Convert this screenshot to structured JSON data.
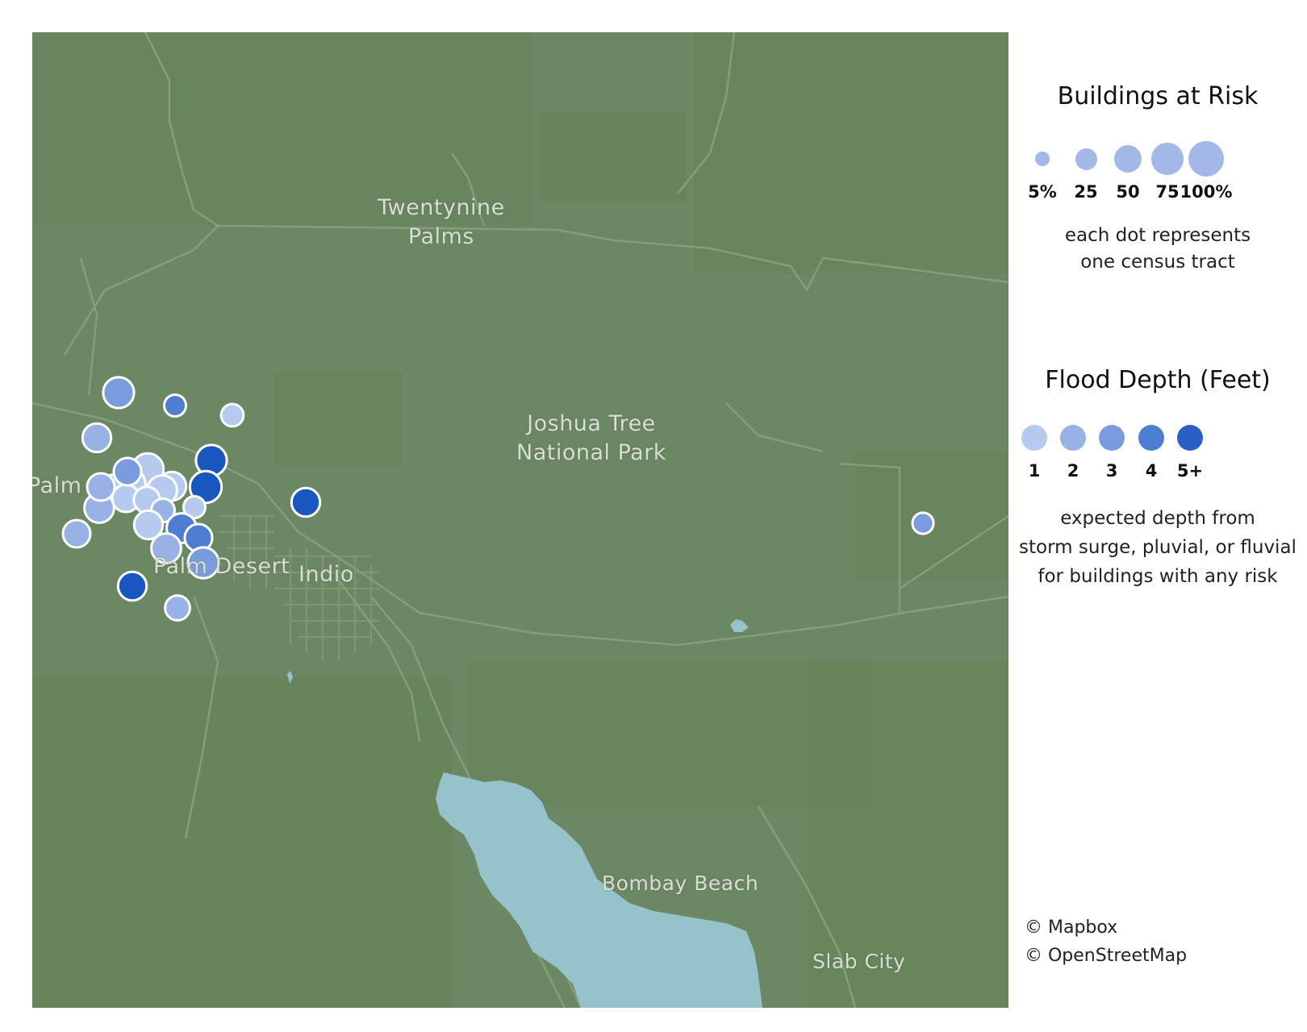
{
  "map": {
    "places": [
      {
        "name": "Twentynine Palms",
        "line1": "Twentynine",
        "line2": "Palms"
      },
      {
        "name": "Joshua Tree National Park",
        "line1": "Joshua Tree",
        "line2": "National Park"
      },
      {
        "name": "Palm",
        "line1": "Palm",
        "line2": ""
      },
      {
        "name": "Palm Desert",
        "line1": "Palm Desert",
        "line2": ""
      },
      {
        "name": "Indio",
        "line1": "Indio",
        "line2": ""
      },
      {
        "name": "Bombay Beach",
        "line1": "Bombay Beach",
        "line2": ""
      },
      {
        "name": "Slab City",
        "line1": "Slab City",
        "line2": ""
      }
    ],
    "colors": {
      "land": "#6b8763",
      "land_dark": "#63814f",
      "water": "#96c3cb",
      "road": "#8aa07f",
      "marker_stroke": "#ffffff",
      "depth_1": "#b6c9ee",
      "depth_2": "#98b2e6",
      "depth_3": "#7a9cdf",
      "depth_4": "#4f7dd2",
      "depth_5plus": "#1a56bf"
    },
    "tracts": [
      {
        "buildings_at_risk_pct": 55,
        "flood_depth_ft": 3
      },
      {
        "buildings_at_risk_pct": 20,
        "flood_depth_ft": 4
      },
      {
        "buildings_at_risk_pct": 22,
        "flood_depth_ft": 1
      },
      {
        "buildings_at_risk_pct": 45,
        "flood_depth_ft": 2
      },
      {
        "buildings_at_risk_pct": 40,
        "flood_depth_ft": 2
      },
      {
        "buildings_at_risk_pct": 50,
        "flood_depth_ft": 2
      },
      {
        "buildings_at_risk_pct": 60,
        "flood_depth_ft": 1
      },
      {
        "buildings_at_risk_pct": 55,
        "flood_depth_ft": 1
      },
      {
        "buildings_at_risk_pct": 45,
        "flood_depth_ft": 1
      },
      {
        "buildings_at_risk_pct": 20,
        "flood_depth_ft": 1
      },
      {
        "buildings_at_risk_pct": 50,
        "flood_depth_ft": 1
      },
      {
        "buildings_at_risk_pct": 40,
        "flood_depth_ft": 1
      },
      {
        "buildings_at_risk_pct": 35,
        "flood_depth_ft": 1
      },
      {
        "buildings_at_risk_pct": 55,
        "flood_depth_ft": 5
      },
      {
        "buildings_at_risk_pct": 60,
        "flood_depth_ft": 5
      },
      {
        "buildings_at_risk_pct": 40,
        "flood_depth_ft": 3
      },
      {
        "buildings_at_risk_pct": 20,
        "flood_depth_ft": 1
      },
      {
        "buildings_at_risk_pct": 25,
        "flood_depth_ft": 2
      },
      {
        "buildings_at_risk_pct": 45,
        "flood_depth_ft": 1
      },
      {
        "buildings_at_risk_pct": 50,
        "flood_depth_ft": 4
      },
      {
        "buildings_at_risk_pct": 40,
        "flood_depth_ft": 4
      },
      {
        "buildings_at_risk_pct": 55,
        "flood_depth_ft": 3
      },
      {
        "buildings_at_risk_pct": 50,
        "flood_depth_ft": 2
      },
      {
        "buildings_at_risk_pct": 40,
        "flood_depth_ft": 2
      },
      {
        "buildings_at_risk_pct": 45,
        "flood_depth_ft": 5
      },
      {
        "buildings_at_risk_pct": 30,
        "flood_depth_ft": 2
      },
      {
        "buildings_at_risk_pct": 45,
        "flood_depth_ft": 5
      },
      {
        "buildings_at_risk_pct": 18,
        "flood_depth_ft": 3
      }
    ]
  },
  "legend": {
    "size": {
      "title": "Buildings at Risk",
      "items": [
        {
          "label": "5%",
          "value": 5
        },
        {
          "label": "25",
          "value": 25
        },
        {
          "label": "50",
          "value": 50
        },
        {
          "label": "75",
          "value": 75
        },
        {
          "label": "100%",
          "value": 100
        }
      ],
      "note_line1": "each dot represents",
      "note_line2": "one census tract",
      "dot_color": "#a3b8e6"
    },
    "depth": {
      "title": "Flood Depth (Feet)",
      "items": [
        {
          "label": "1",
          "color": "#b6c9ee"
        },
        {
          "label": "2",
          "color": "#98b2e6"
        },
        {
          "label": "3",
          "color": "#7a9cdf"
        },
        {
          "label": "4",
          "color": "#4f7dd2"
        },
        {
          "label": "5+",
          "color": "#2a5fc4"
        }
      ],
      "note_line1": "expected depth from",
      "note_line2": "storm surge, pluvial, or fluvial",
      "note_line3": "for buildings with any risk"
    },
    "credits": [
      "© Mapbox",
      "© OpenStreetMap"
    ]
  }
}
